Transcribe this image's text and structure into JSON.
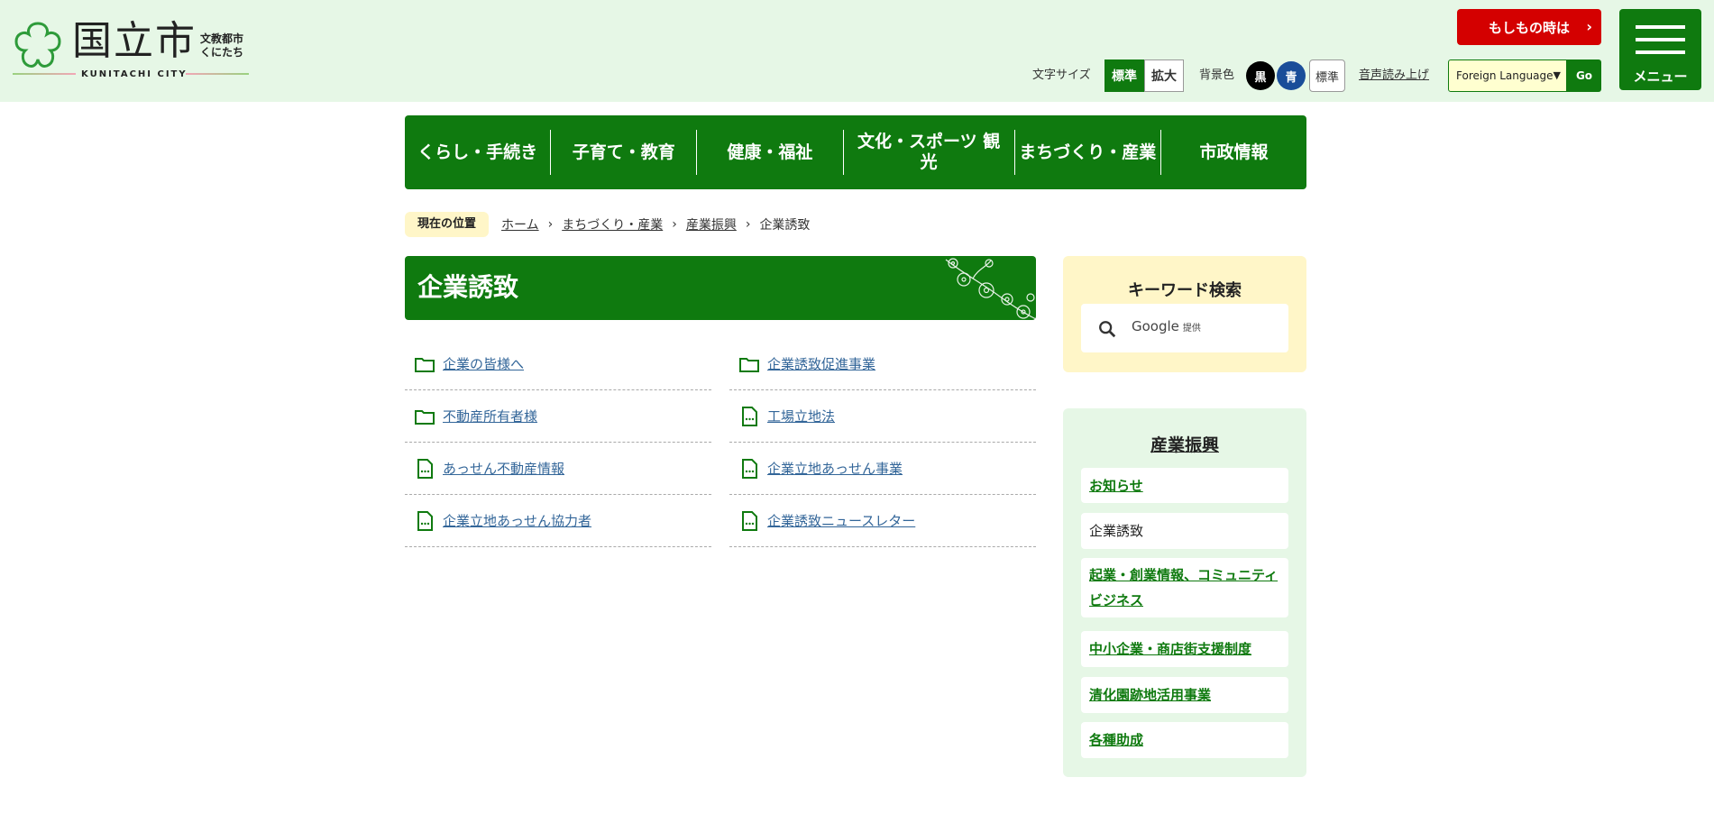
{
  "header": {
    "logo": {
      "name": "国立市",
      "tagline": "文教都市 くにたち",
      "city_en": "KUNITACHI CITY"
    },
    "emergency_label": "もしもの時は",
    "menu_label": "メニュー",
    "font_size_label": "文字サイズ",
    "font_size_options": [
      "標準",
      "拡大"
    ],
    "bg_color_label": "背景色",
    "bg_options": [
      "黒",
      "青",
      "標準"
    ],
    "read_aloud": "音声読み上げ",
    "language_select": "Foreign Language",
    "go_label": "Go",
    "colors": {
      "header_bg": "#e6f7e6",
      "brand_green": "#0f7a0f",
      "emergency_red": "#d40000"
    }
  },
  "gnav": [
    "くらし・手続き",
    "子育て・教育",
    "健康・福祉",
    "文化・スポーツ 観光",
    "まちづくり・産業",
    "市政情報"
  ],
  "breadcrumb": {
    "here_label": "現在の位置",
    "items": [
      "ホーム",
      "まちづくり・産業",
      "産業振興"
    ],
    "current": "企業誘致"
  },
  "main": {
    "title": "企業誘致",
    "links": [
      {
        "label": "企業の皆様へ",
        "icon": "folder-icon"
      },
      {
        "label": "企業誘致促進事業",
        "icon": "folder-icon"
      },
      {
        "label": "不動産所有者様",
        "icon": "folder-icon"
      },
      {
        "label": "工場立地法",
        "icon": "document-icon"
      },
      {
        "label": "あっせん不動産情報",
        "icon": "document-icon"
      },
      {
        "label": "企業立地あっせん事業",
        "icon": "document-icon"
      },
      {
        "label": "企業立地あっせん協力者",
        "icon": "document-icon"
      },
      {
        "label": "企業誘致ニュースレター",
        "icon": "document-icon"
      }
    ]
  },
  "sidebar": {
    "search": {
      "title": "キーワード検索",
      "placeholder": "Google",
      "provided": "提供"
    },
    "section_title": "産業振興",
    "items": [
      {
        "label": "お知らせ",
        "current": false
      },
      {
        "label": "企業誘致",
        "current": true
      },
      {
        "label": "起業・創業情報、コミュニティビジネス",
        "current": false
      },
      {
        "label": "中小企業・商店街支援制度",
        "current": false
      },
      {
        "label": "清化園跡地活用事業",
        "current": false
      },
      {
        "label": "各種助成",
        "current": false
      }
    ]
  }
}
